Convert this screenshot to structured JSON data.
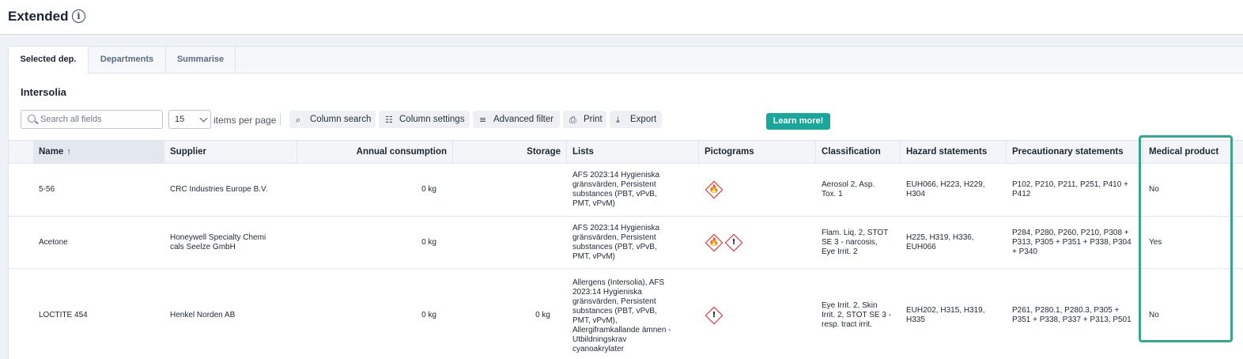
{
  "header": {
    "title": "Extended"
  },
  "tabs": [
    {
      "label": "Selected dep."
    },
    {
      "label": "Departments"
    },
    {
      "label": "Summarise"
    }
  ],
  "department": "Intersolia",
  "toolbar": {
    "search_placeholder": "Search all fields",
    "per_page_value": "15",
    "per_page_label": "items per page",
    "column_search": "Column search",
    "column_settings": "Column settings",
    "advanced_filter": "Advanced filter",
    "print": "Print",
    "export": "Export",
    "learn_more": "Learn more!"
  },
  "columns": {
    "name": "Name",
    "supplier": "Supplier",
    "annual": "Annual consumption",
    "storage": "Storage",
    "lists": "Lists",
    "pictograms": "Pictograms",
    "classification": "Classification",
    "hazard": "Hazard statements",
    "precautionary": "Precautionary statements",
    "medical": "Medical product"
  },
  "rows": [
    {
      "name": "5-56",
      "supplier": "CRC Industries Europe B.V.",
      "annual": "0 kg",
      "storage": "",
      "lists": "AFS 2023:14 Hygieniska\ngränsvärden, Persistent\nsubstances (PBT, vPvB,\nPMT, vPvM)",
      "pictograms": [
        "flame"
      ],
      "classification": "Aerosol 2, Asp.\nTox. 1",
      "hazard": "EUH066, H223, H229,\nH304",
      "precautionary": "P102, P210, P211, P251, P410 +\nP412",
      "medical": "No"
    },
    {
      "name": "Acetone",
      "supplier": "Honeywell Specialty Chemi\ncals Seelze GmbH",
      "annual": "0 kg",
      "storage": "",
      "lists": "AFS 2023:14 Hygieniska\ngränsvärden, Persistent\nsubstances (PBT, vPvB,\nPMT, vPvM)",
      "pictograms": [
        "flame",
        "exclamation"
      ],
      "classification": "Flam. Liq. 2, STOT\nSE 3 - narcosis,\nEye Irrit. 2",
      "hazard": "H225, H319, H336,\nEUH066",
      "precautionary": "P284, P280, P260, P210, P308 +\nP313, P305 + P351 + P338, P304\n+ P340",
      "medical": "Yes"
    },
    {
      "name": "LOCTITE 454",
      "supplier": "Henkel Norden AB",
      "annual": "0 kg",
      "storage": "0 kg",
      "lists": "Allergens (Intersolia), AFS\n2023:14 Hygieniska\ngränsvärden, Persistent\nsubstances (PBT, vPvB,\nPMT, vPvM),\nAllergiframkallande ämnen -\nUtbildningskrav\ncyanoakrylater",
      "pictograms": [
        "exclamation"
      ],
      "classification": "Eye Irrit. 2, Skin\nIrrit. 2, STOT SE 3 -\nresp. tract irrit.",
      "hazard": "EUH202, H315, H319,\nH335",
      "precautionary": "P261, P280.1, P280.3, P305 +\nP351 + P338, P337 + P313, P501",
      "medical": "No"
    }
  ],
  "colors": {
    "accent": "#1aa69a",
    "highlight": "#3aa58e",
    "ghs_red": "#e0232d"
  }
}
